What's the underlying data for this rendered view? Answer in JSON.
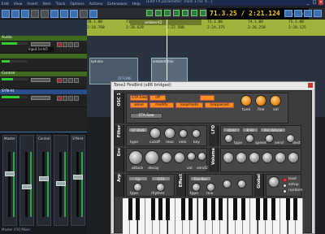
{
  "window": {
    "title": "[Edit FX parameter: Track 1 (Sl: X...]",
    "menu": [
      "Edit",
      "View",
      "Insert",
      "Item",
      "Track",
      "Options",
      "Actions",
      "Extensions",
      "Help"
    ]
  },
  "transport": {
    "timecode": "71.3.25 / 2:21.124",
    "state": "[Stopped]"
  },
  "timeline": {
    "region_label": "ambient2",
    "bars": [
      "70.1.00",
      "71.1.00",
      "72.1.00",
      "73.1.00",
      "74.1.00",
      "75.1.00"
    ],
    "times": [
      "2:18.760",
      "2:20.629",
      "2:22.500",
      "2:24.375",
      "2:26.250",
      "2:28.125"
    ]
  },
  "clips": [
    {
      "label": "lyd-mix"
    },
    {
      "label": "ambient-mix"
    }
  ],
  "clip_extra": "OFFLINE",
  "tracks": [
    {
      "name": "Audio",
      "input": "Input 1+In5",
      "color": "#3e6b1e"
    },
    {
      "name": "Control",
      "input": "",
      "color": "#3e6b1e"
    },
    {
      "name": "SYN-ht",
      "input": "",
      "color": "#2a4e8a"
    }
  ],
  "mixer": {
    "strips": [
      "Master",
      "",
      "Control",
      "",
      "SYN-ht"
    ],
    "footer": "Master [FX] Mixer"
  },
  "plugin": {
    "window_title": "Tone2 FireBird (x86 bridged)",
    "osc1": {
      "side": "OSC 1",
      "preset": "STA.Saw",
      "wave_opts": [
        "wave",
        "modify",
        "loopmode",
        "looppaced",
        "tune",
        "fine",
        "vol"
      ]
    },
    "filter": {
      "side": "Filter",
      "type": "LP 36dB",
      "knobs": [
        "type",
        "cutoff",
        "reso",
        "velo",
        "key"
      ]
    },
    "lfo": {
      "side": "LFO",
      "type": "static",
      "speed": "8 Hz",
      "dest": "Osc.detune",
      "knobs": [
        "type",
        "speed",
        "send",
        "dest"
      ]
    },
    "env": {
      "side": "Env",
      "knobs": [
        "attack",
        "decay",
        "sustain",
        "release",
        "vol",
        "send2",
        "send3"
      ]
    },
    "volume": {
      "side": "Volume",
      "knobs": [
        "a",
        "d",
        "s",
        "r",
        "vel",
        "send"
      ]
    },
    "arp": {
      "side": "Arp",
      "mode": "Up",
      "rhythm": "1/16",
      "knobs": [
        "type",
        "rhythm"
      ]
    },
    "effect": {
      "side": "Effect",
      "type": "Ens-Rev",
      "knobs": [
        "type",
        "mix",
        "fx1",
        "fx2"
      ]
    },
    "global": {
      "side": "Global",
      "options": [
        "load",
        "setup",
        "random"
      ]
    },
    "brand": "Tone2 FireBird"
  }
}
